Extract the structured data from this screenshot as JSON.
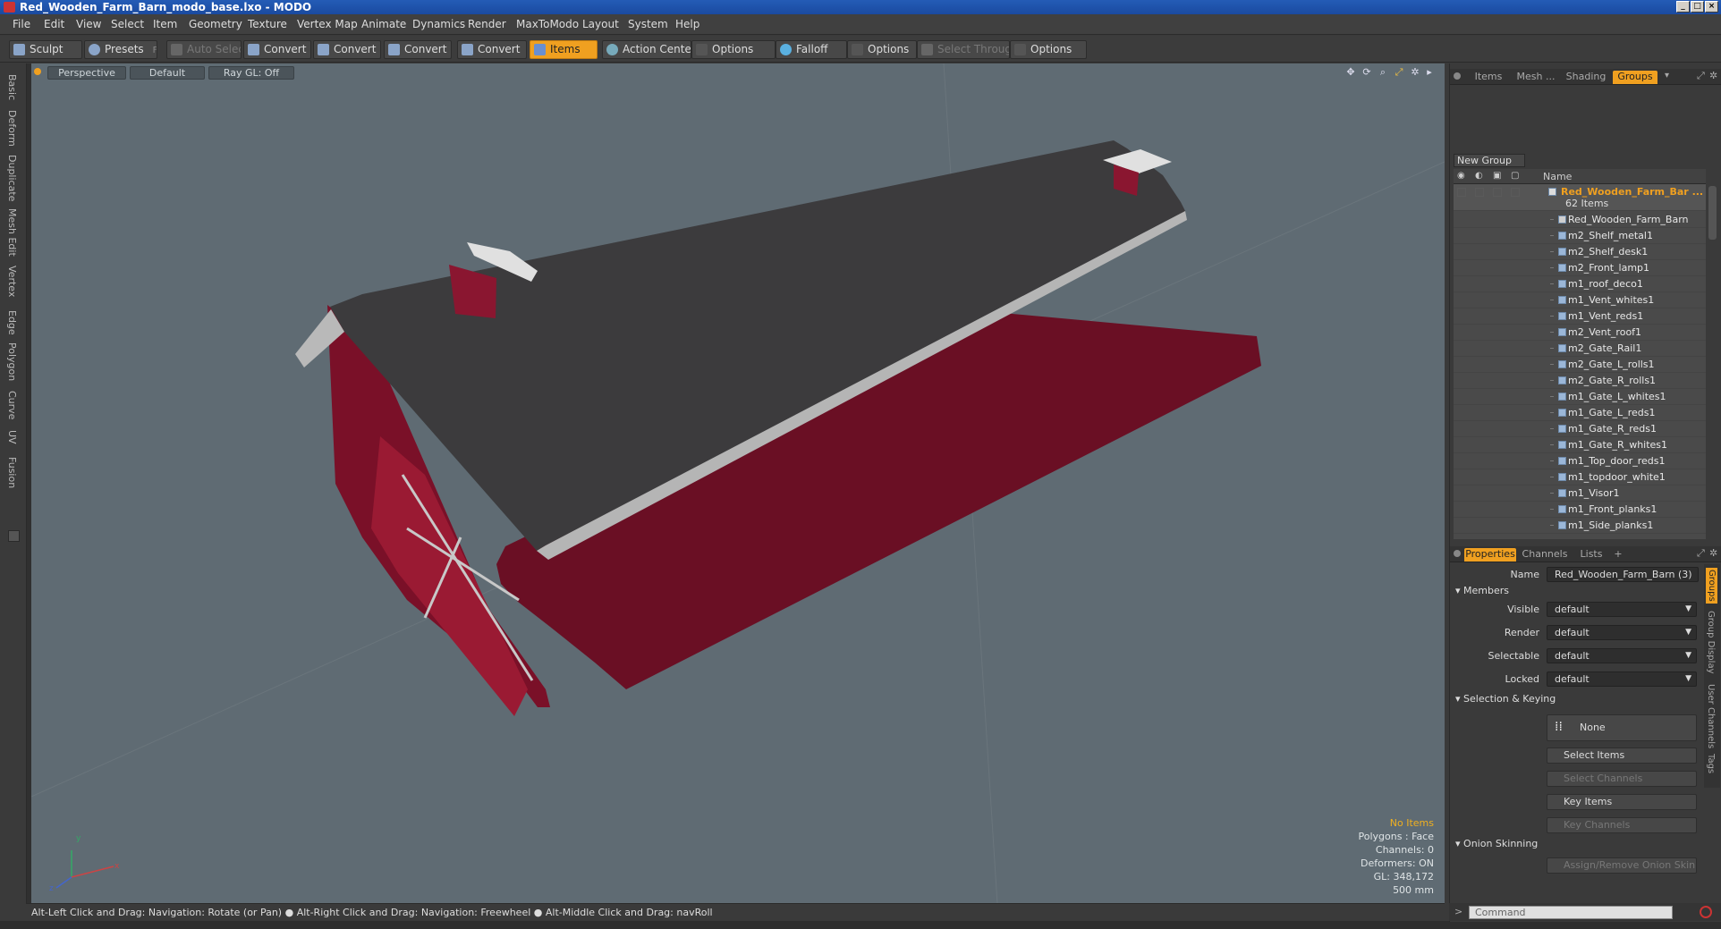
{
  "window": {
    "title": "Red_Wooden_Farm_Barn_modo_base.lxo - MODO"
  },
  "menu": [
    "File",
    "Edit",
    "View",
    "Select",
    "Item",
    "Geometry",
    "Texture",
    "Vertex Map",
    "Animate",
    "Dynamics",
    "Render",
    "MaxToModo",
    "Layout",
    "System",
    "Help"
  ],
  "toolbar": {
    "sculpt": "Sculpt",
    "presets": "Presets",
    "presets_key": "F6",
    "auto_select": "Auto Select",
    "convert": "Convert",
    "items": "Items",
    "action_center": "Action Center",
    "options": "Options",
    "falloff": "Falloff",
    "select_through": "Select Through"
  },
  "left_tabs": [
    "Basic",
    "Deform",
    "Duplicate",
    "Mesh Edit",
    "Vertex",
    "Edge",
    "Polygon",
    "Curve",
    "UV",
    "Fusion"
  ],
  "viewport": {
    "view": "Perspective",
    "shading": "Default",
    "raygl": "Ray GL: Off",
    "hud": {
      "items": "No Items",
      "polygons": "Polygons : Face",
      "channels": "Channels: 0",
      "deformers": "Deformers: ON",
      "gl": "GL: 348,172",
      "scale": "500 mm"
    },
    "axis": {
      "x": "x",
      "y": "y",
      "z": "z"
    }
  },
  "status": "Alt-Left Click and Drag: Navigation: Rotate (or Pan) ● Alt-Right Click and Drag: Navigation: Freewheel ● Alt-Middle Click and Drag: navRoll",
  "right_panel": {
    "tabs": [
      "Items",
      "Mesh ...",
      "Shading",
      "Groups"
    ],
    "new_group": "New Group",
    "name_col": "Name",
    "group": {
      "name": "Red_Wooden_Farm_Bar ...",
      "count": "62 Items"
    },
    "items": [
      "Red_Wooden_Farm_Barn",
      "m2_Shelf_metal1",
      "m2_Shelf_desk1",
      "m2_Front_lamp1",
      "m1_roof_deco1",
      "m1_Vent_whites1",
      "m1_Vent_reds1",
      "m2_Vent_roof1",
      "m2_Gate_Rail1",
      "m2_Gate_L_rolls1",
      "m2_Gate_R_rolls1",
      "m1_Gate_L_whites1",
      "m1_Gate_L_reds1",
      "m1_Gate_R_reds1",
      "m1_Gate_R_whites1",
      "m1_Top_door_reds1",
      "m1_topdoor_white1",
      "m1_Visor1",
      "m1_Front_planks1",
      "m1_Side_planks1"
    ],
    "prop_tabs": [
      "Properties",
      "Channels",
      "Lists",
      "+"
    ],
    "side_tabs": [
      "Groups",
      "Group Display",
      "User Channels",
      "Tags"
    ],
    "properties": {
      "name_label": "Name",
      "name_value": "Red_Wooden_Farm_Barn (3)",
      "members": "Members",
      "visible_label": "Visible",
      "visible": "default",
      "render_label": "Render",
      "render": "default",
      "selectable_label": "Selectable",
      "selectable": "default",
      "locked_label": "Locked",
      "locked": "default",
      "sel_keying": "Selection & Keying",
      "none": "None",
      "select_items": "Select Items",
      "select_channels": "Select Channels",
      "key_items": "Key Items",
      "key_channels": "Key Channels",
      "onion": "Onion Skinning",
      "assign_onion": "Assign/Remove Onion Skin"
    },
    "command_placeholder": "Command"
  }
}
